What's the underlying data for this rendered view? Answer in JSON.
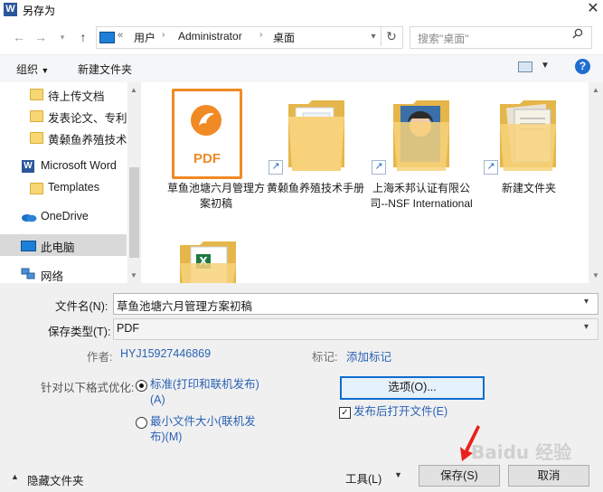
{
  "window": {
    "title": "另存为",
    "app_icon_letter": "W"
  },
  "address": {
    "overflow": "«",
    "crumbs": [
      "用户",
      "Administrator",
      "桌面"
    ],
    "search_placeholder": "搜索\"桌面\""
  },
  "toolbar": {
    "organize": "组织",
    "new_folder": "新建文件夹",
    "help": "?"
  },
  "nav": {
    "items": [
      {
        "label": "待上传文档",
        "icon": "folder-icon"
      },
      {
        "label": "发表论文、专利资",
        "icon": "folder-icon"
      },
      {
        "label": "黄颡鱼养殖技术手",
        "icon": "folder-icon"
      },
      {
        "label": "Microsoft Word",
        "icon": "word-icon"
      },
      {
        "label": "Templates",
        "icon": "folder-icon"
      },
      {
        "label": "OneDrive",
        "icon": "onedrive-icon"
      },
      {
        "label": "此电脑",
        "icon": "computer-icon",
        "selected": true
      },
      {
        "label": "网络",
        "icon": "network-icon"
      }
    ]
  },
  "files": [
    {
      "label": "草鱼池塘六月管理方案初稿",
      "type": "pdf",
      "badge": "PDF"
    },
    {
      "label": "黄颡鱼养殖技术手册",
      "type": "shortcut-folder"
    },
    {
      "label": "上海禾邦认证有限公司--NSF International",
      "type": "shortcut-folder-photo"
    },
    {
      "label": "新建文件夹",
      "type": "shortcut-folder-doc"
    },
    {
      "label": "",
      "type": "excel-folder"
    }
  ],
  "form": {
    "filename_label": "文件名(N):",
    "filename_value": "草鱼池塘六月管理方案初稿",
    "type_label": "保存类型(T):",
    "type_value": "PDF",
    "author_label": "作者:",
    "author_value": "HYJ15927446869",
    "tags_label": "标记:",
    "tags_value": "添加标记",
    "optimize_label": "针对以下格式优化:",
    "opt_standard_line1": "标准(打印和联机发布)",
    "opt_standard_line2": "(A)",
    "opt_min_line1": "最小文件大小(联机发",
    "opt_min_line2": "布)(M)",
    "options_button": "选项(O)...",
    "open_after": "发布后打开文件(E)",
    "hide_folders": "隐藏文件夹",
    "tools": "工具(L)",
    "save": "保存(S)",
    "cancel": "取消"
  },
  "watermark": "Baidu 经验"
}
